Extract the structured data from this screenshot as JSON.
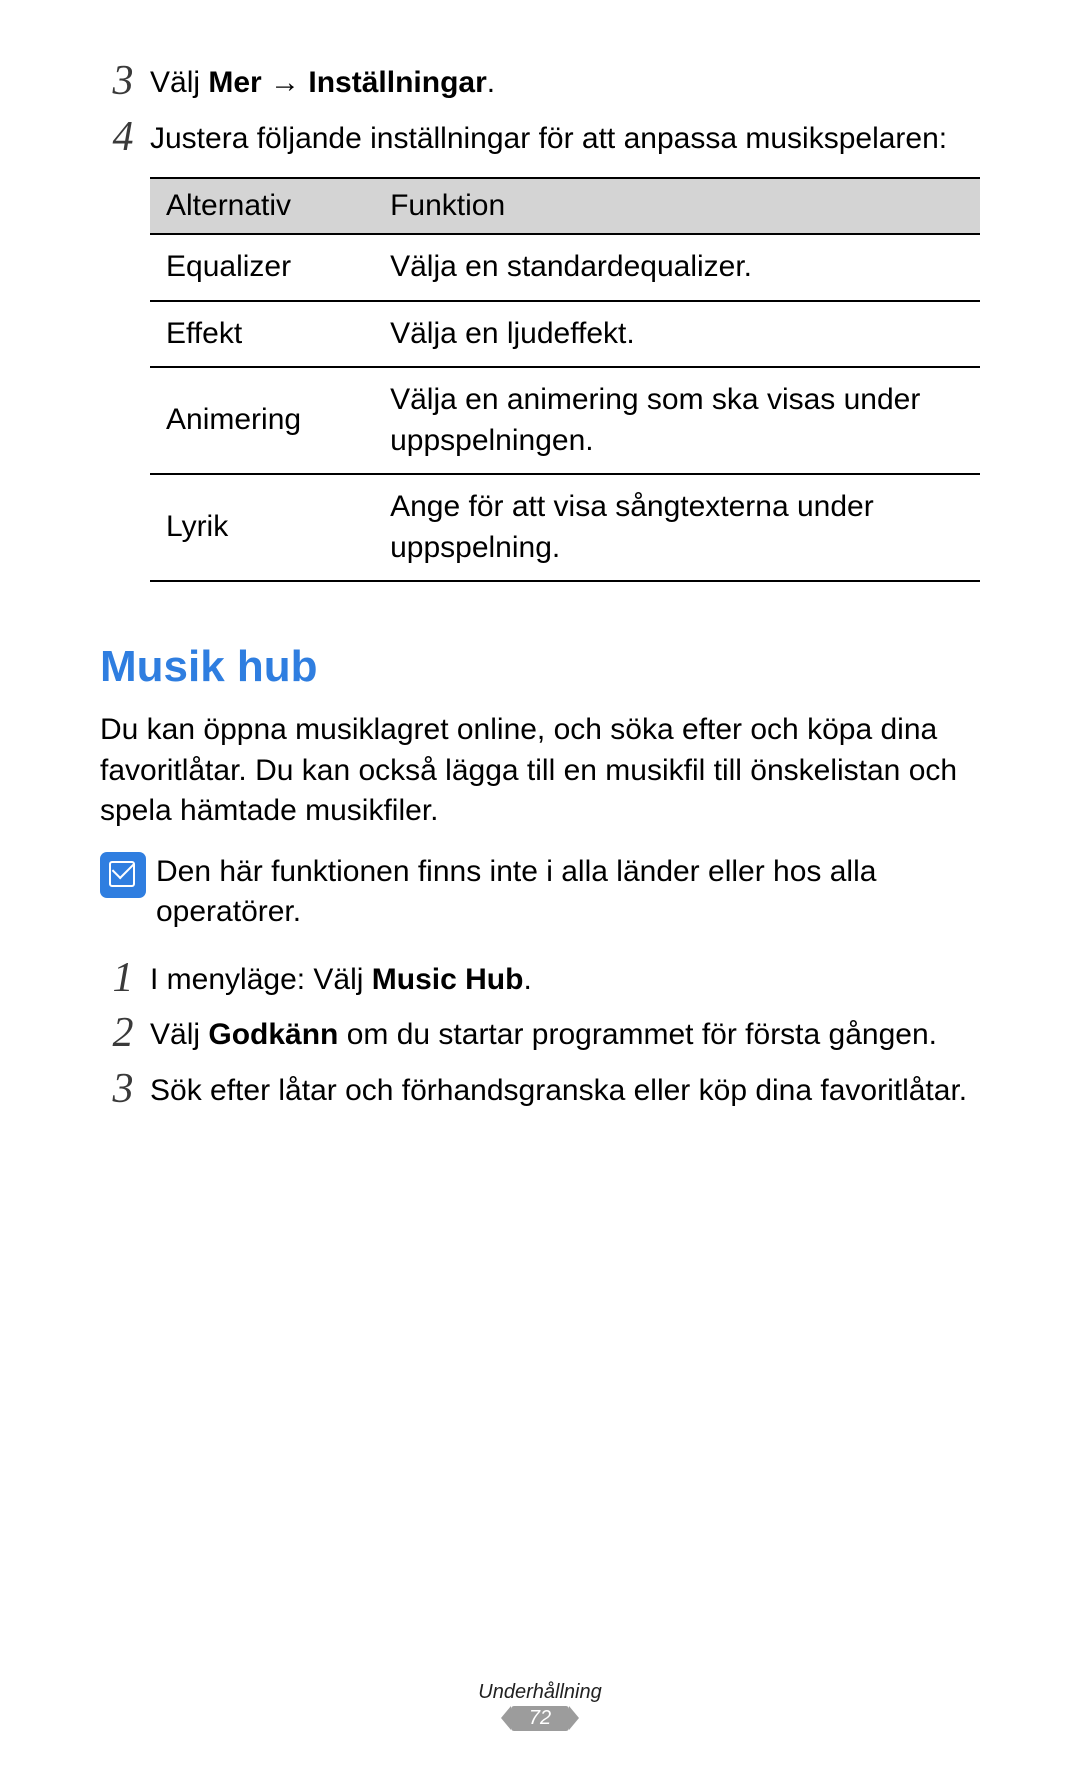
{
  "steps_top": [
    {
      "num": "3",
      "parts": [
        {
          "text": "Välj ",
          "bold": false
        },
        {
          "text": "Mer",
          "bold": true
        },
        {
          "text": " → ",
          "bold": false
        },
        {
          "text": "Inställningar",
          "bold": true
        },
        {
          "text": ".",
          "bold": false
        }
      ]
    },
    {
      "num": "4",
      "parts": [
        {
          "text": "Justera följande inställningar för att anpassa musikspelaren:",
          "bold": false
        }
      ]
    }
  ],
  "table": {
    "headers": {
      "option": "Alternativ",
      "function": "Funktion"
    },
    "rows": [
      {
        "option": "Equalizer",
        "function": "Välja en standardequalizer."
      },
      {
        "option": "Effekt",
        "function": "Välja en ljudeffekt."
      },
      {
        "option": "Animering",
        "function": "Välja en animering som ska visas under uppspelningen."
      },
      {
        "option": "Lyrik",
        "function": "Ange för att visa sångtexterna under uppspelning."
      }
    ]
  },
  "section": {
    "title": "Musik hub",
    "intro": "Du kan öppna musiklagret online, och söka efter och köpa dina favoritlåtar. Du kan också lägga till en musikfil till önskelistan och spela hämtade musikfiler.",
    "note": "Den här funktionen finns inte i alla länder eller hos alla operatörer.",
    "steps": [
      {
        "num": "1",
        "parts": [
          {
            "text": "I menyläge: Välj ",
            "bold": false
          },
          {
            "text": "Music Hub",
            "bold": true
          },
          {
            "text": ".",
            "bold": false
          }
        ]
      },
      {
        "num": "2",
        "parts": [
          {
            "text": "Välj ",
            "bold": false
          },
          {
            "text": "Godkänn",
            "bold": true
          },
          {
            "text": " om du startar programmet för första gången.",
            "bold": false
          }
        ]
      },
      {
        "num": "3",
        "parts": [
          {
            "text": "Sök efter låtar och förhandsgranska eller köp dina favoritlåtar.",
            "bold": false
          }
        ]
      }
    ]
  },
  "footer": {
    "category": "Underhållning",
    "page": "72"
  }
}
